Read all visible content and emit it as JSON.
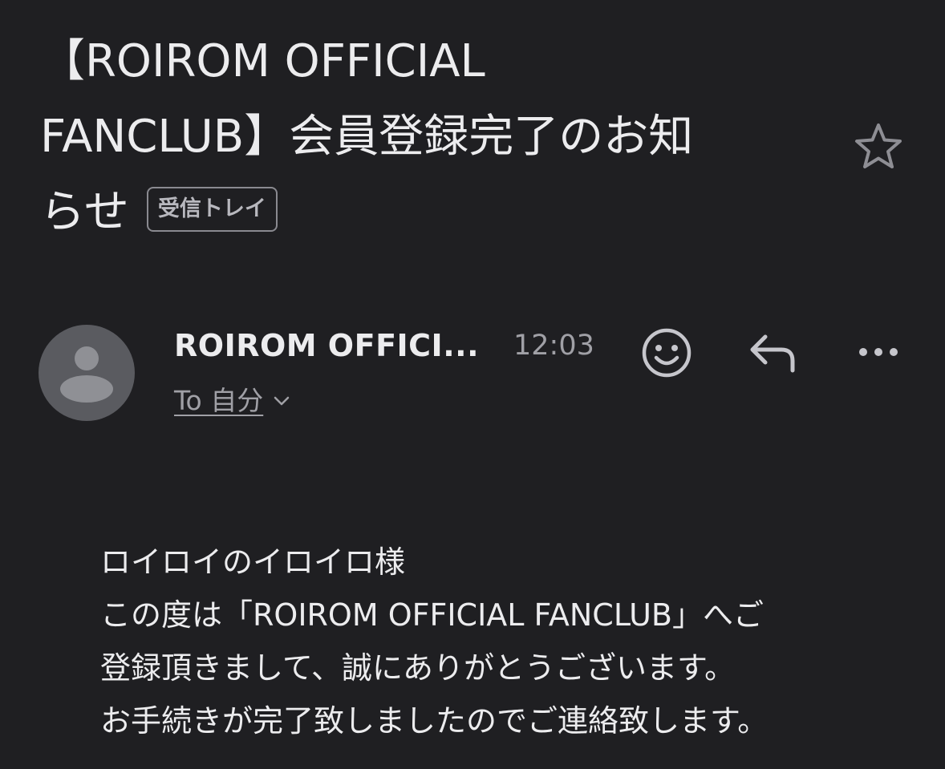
{
  "email": {
    "subject_lines": [
      "【ROIROM OFFICIAL",
      "FANCLUB】会員登録完了のお知",
      "らせ"
    ],
    "label": "受信トレイ",
    "sender": "ROIROM OFFICI...",
    "time": "12:03",
    "recipient": "To 自分",
    "body_lines": [
      "ロイロイのイロイロ様",
      "この度は「ROIROM OFFICIAL FANCLUB」へご",
      "登録頂きまして、誠にありがとうございます。",
      "お手続きが完了致しましたのでご連絡致します。"
    ]
  },
  "icons": {
    "star": "star-outline-icon",
    "avatar": "default-person-avatar",
    "emoji": "smiley-icon",
    "reply": "reply-arrow-icon",
    "more": "more-horizontal-icon",
    "chevron": "chevron-down-icon"
  },
  "colors": {
    "background": "#1f1f22",
    "text": "#ececee",
    "muted": "#a0a0a6",
    "avatar": "#5a5b60"
  }
}
